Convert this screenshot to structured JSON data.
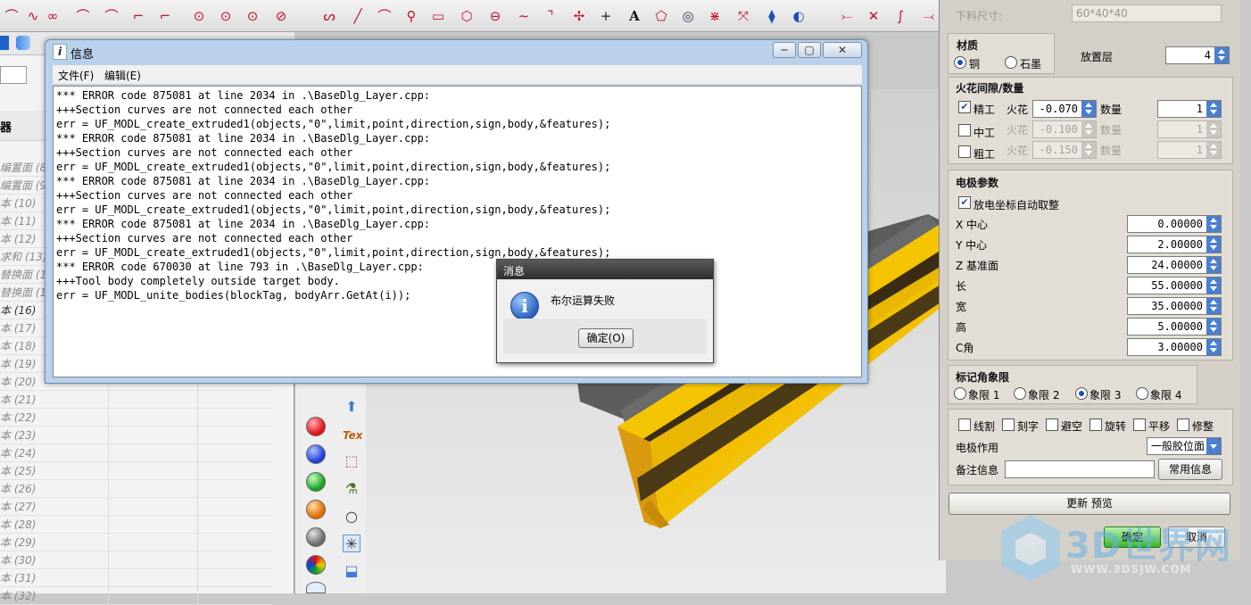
{
  "info_window": {
    "title": "信息",
    "menu": [
      "文件(F)",
      "编辑(E)"
    ],
    "log_lines": [
      "*** ERROR code 875081 at line 2034 in .\\BaseDlg_Layer.cpp:",
      "+++Section curves are not connected each other",
      "err = UF_MODL_create_extruded1(objects,\"0\",limit,point,direction,sign,body,&features);",
      "*** ERROR code 875081 at line 2034 in .\\BaseDlg_Layer.cpp:",
      "+++Section curves are not connected each other",
      "err = UF_MODL_create_extruded1(objects,\"0\",limit,point,direction,sign,body,&features);",
      "*** ERROR code 875081 at line 2034 in .\\BaseDlg_Layer.cpp:",
      "+++Section curves are not connected each other",
      "err = UF_MODL_create_extruded1(objects,\"0\",limit,point,direction,sign,body,&features);",
      "*** ERROR code 875081 at line 2034 in .\\BaseDlg_Layer.cpp:",
      "+++Section curves are not connected each other",
      "err = UF_MODL_create_extruded1(objects,\"0\",limit,point,direction,sign,body,&features);",
      "*** ERROR code 670030 at line 793 in .\\BaseDlg_Layer.cpp:",
      "+++Tool body completely outside target body.",
      "err = UF_MODL_unite_bodies(blockTag, bodyArr.GetAt(i));"
    ]
  },
  "message_box": {
    "title": "消息",
    "text": "布尔运算失败",
    "ok_label": "确定(O)"
  },
  "navigator": {
    "header": "器",
    "rows": [
      "编置面 (8)",
      "编置面 (9)",
      "本 (10)",
      "本 (11)",
      "本 (12)",
      "求和 (13)",
      "替换面 (1",
      "替换面 (1",
      "本 (16)",
      "本 (17)",
      "本 (18)",
      "本 (19)",
      "本 (20)",
      "本 (21)",
      "本 (22)",
      "本 (23)",
      "本 (24)",
      "本 (25)",
      "本 (26)",
      "本 (27)",
      "本 (28)",
      "本 (29)",
      "本 (30)",
      "本 (31)",
      "本 (32)"
    ]
  },
  "panel": {
    "stock_label": "下料尺寸:",
    "stock_value": "60*40*40",
    "material": {
      "title": "材质",
      "options": [
        "铜",
        "石墨"
      ],
      "selected": "铜",
      "layer_label": "放置层",
      "layer_value": "4"
    },
    "spark": {
      "title": "火花间隙/数量",
      "rows": [
        {
          "label": "精工",
          "checked": true,
          "spark_label": "火花",
          "gap": "-0.070",
          "count_label": "数量",
          "count": "1",
          "enabled": true
        },
        {
          "label": "中工",
          "checked": false,
          "spark_label": "火花",
          "gap": "-0.100",
          "count_label": "数量",
          "count": "1",
          "enabled": false
        },
        {
          "label": "粗工",
          "checked": false,
          "spark_label": "火花",
          "gap": "-0.150",
          "count_label": "数量",
          "count": "1",
          "enabled": false
        }
      ]
    },
    "electrode": {
      "title": "电极参数",
      "auto_label": "放电坐标自动取整",
      "auto_checked": true,
      "params": [
        {
          "label": "X 中心",
          "value": "0.00000"
        },
        {
          "label": "Y 中心",
          "value": "2.00000"
        },
        {
          "label": "Z 基准面",
          "value": "24.00000"
        },
        {
          "label": "长",
          "value": "55.00000"
        },
        {
          "label": "宽",
          "value": "35.00000"
        },
        {
          "label": "高",
          "value": "5.00000"
        },
        {
          "label": "C角",
          "value": "3.00000"
        }
      ]
    },
    "quadrant": {
      "title": "标记角象限",
      "options": [
        "象限 1",
        "象限 2",
        "象限 3",
        "象限 4"
      ],
      "selected": "象限 3"
    },
    "options": {
      "checks": [
        "线割",
        "刻字",
        "避空",
        "旋转",
        "平移",
        "修整"
      ],
      "function_label": "电极作用",
      "function_value": "一般胶位面",
      "note_label": "备注信息",
      "note_value": "",
      "common_btn": "常用信息"
    },
    "update_btn": "更新 预览",
    "ok_btn": "确定",
    "cancel_btn": "取消"
  },
  "watermark": {
    "brand": "3D世界网",
    "url": "WWW.3DSJW.COM"
  },
  "colors": {
    "part_yellow": "#f5c400",
    "part_orange": "#d99a10",
    "part_dark": "#3a2c14",
    "window_frame": "#b9d1ea",
    "accent_blue": "#4a7fd0"
  }
}
